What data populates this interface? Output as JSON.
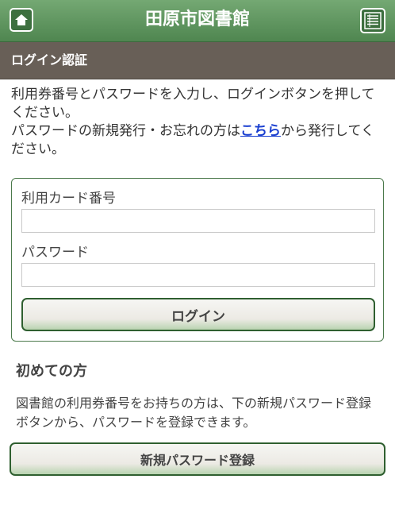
{
  "header": {
    "title": "田原市図書館",
    "home_icon": "home-icon",
    "menu_icon": "list-menu-icon"
  },
  "section": {
    "title": "ログイン認証"
  },
  "intro": {
    "line1": "利用券番号とパスワードを入力し、ログインボタンを押してください。",
    "line2_before": "パスワードの新規発行・お忘れの方は",
    "link_text": "こちら",
    "line2_after": "から発行してください。"
  },
  "login_form": {
    "card_label": "利用カード番号",
    "card_value": "",
    "password_label": "パスワード",
    "password_value": "",
    "login_button": "ログイン"
  },
  "first_time": {
    "title": "初めての方",
    "description": "図書館の利用券番号をお持ちの方は、下の新規パスワード登録ボタンから、パスワードを登録できます。",
    "register_button": "新規パスワード登録"
  },
  "colors": {
    "header_green": "#5f9660",
    "section_brown": "#685f57",
    "link_blue": "#1a3fd0",
    "button_border": "#2f5f30"
  }
}
